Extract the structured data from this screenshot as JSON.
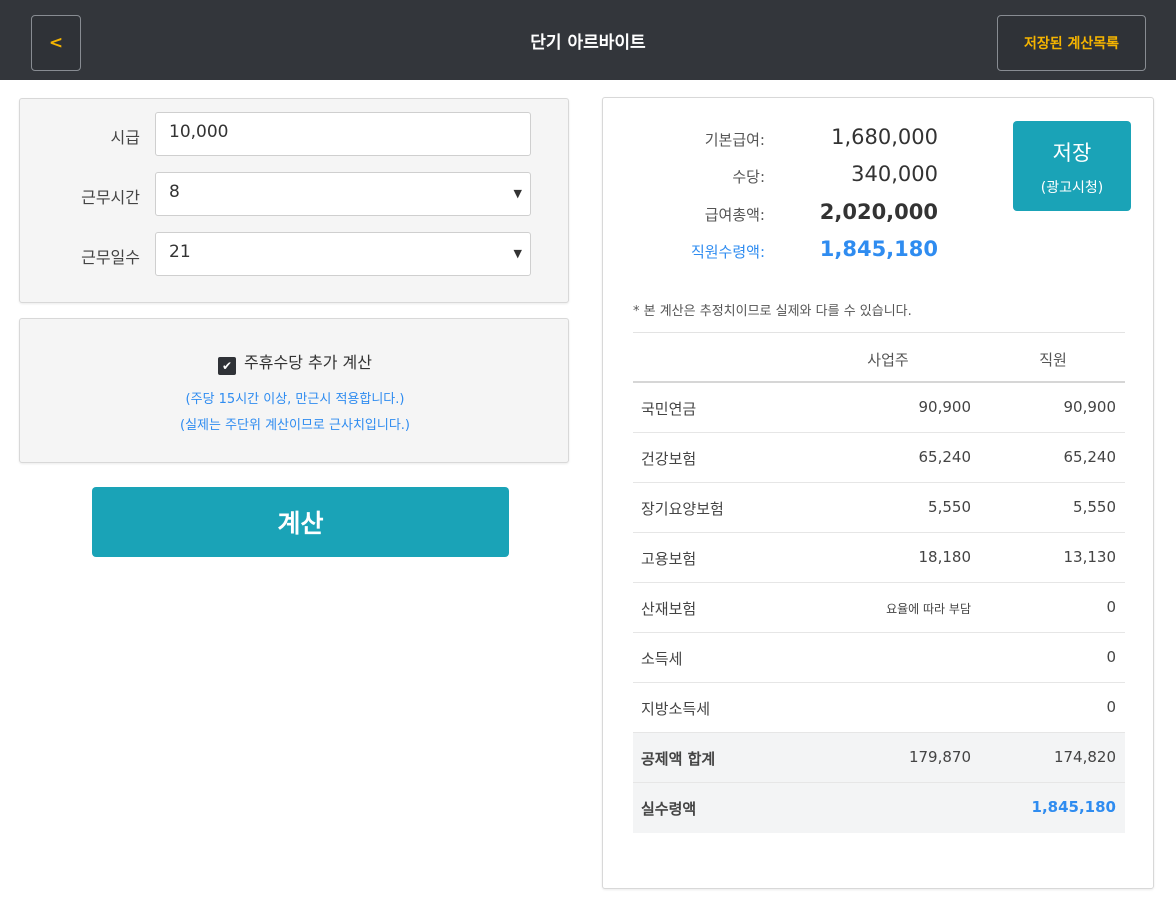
{
  "header": {
    "back_label": "<",
    "title": "단기 아르바이트",
    "saved_list_label": "저장된 계산목록"
  },
  "form": {
    "wage_label": "시급",
    "wage_value": "10,000",
    "hours_label": "근무시간",
    "hours_value": "8",
    "days_label": "근무일수",
    "days_value": "21"
  },
  "holiday": {
    "checked": true,
    "label": "주휴수당 추가 계산",
    "note1": "(주당 15시간 이상, 만근시 적용합니다.)",
    "note2": "(실제는 주단위 계산이므로 근사치입니다.)"
  },
  "calc_button": "계산",
  "summary": {
    "base_label": "기본급여:",
    "base_value": "1,680,000",
    "allowance_label": "수당:",
    "allowance_value": "340,000",
    "total_label": "급여총액:",
    "total_value": "2,020,000",
    "net_label": "직원수령액:",
    "net_value": "1,845,180"
  },
  "save_button": {
    "main": "저장",
    "sub": "(광고시청)"
  },
  "disclaimer": "* 본 계산은 추정치이므로 실제와 다를 수 있습니다.",
  "table": {
    "header_employer": "사업주",
    "header_worker": "직원",
    "rows": [
      {
        "name": "국민연금",
        "employer": "90,900",
        "worker": "90,900"
      },
      {
        "name": "건강보험",
        "employer": "65,240",
        "worker": "65,240"
      },
      {
        "name": "장기요양보험",
        "employer": "5,550",
        "worker": "5,550"
      },
      {
        "name": "고용보험",
        "employer": "18,180",
        "worker": "13,130"
      },
      {
        "name": "산재보험",
        "employer": "요율에 따라 부담",
        "worker": "0"
      },
      {
        "name": "소득세",
        "employer": "",
        "worker": "0"
      },
      {
        "name": "지방소득세",
        "employer": "",
        "worker": "0"
      }
    ],
    "sum": {
      "name": "공제액 합계",
      "employer": "179,870",
      "worker": "174,820"
    },
    "net": {
      "name": "실수령액",
      "employer": "",
      "worker": "1,845,180"
    }
  },
  "colors": {
    "topbar": "#33363b",
    "accent_yellow": "#f5b400",
    "teal": "#1aa3b7",
    "blue": "#2f8cf0"
  }
}
